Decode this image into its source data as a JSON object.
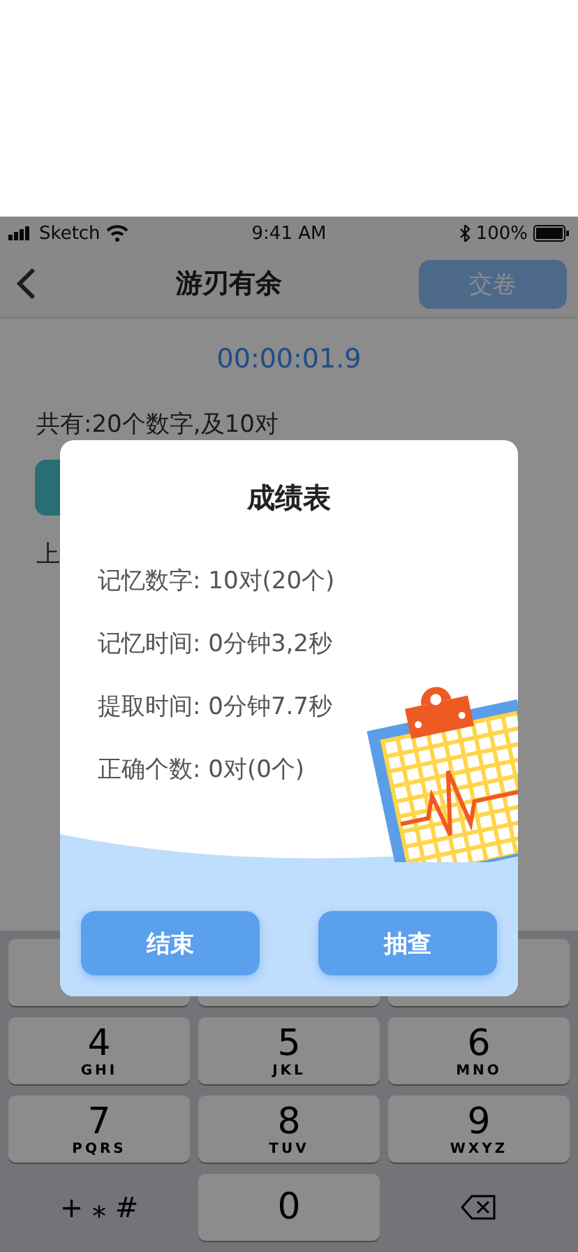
{
  "status_bar": {
    "carrier": "Sketch",
    "time": "9:41 AM",
    "battery": "100%"
  },
  "nav": {
    "title": "游刃有余",
    "action": "交卷"
  },
  "timer": "00:00:01.9",
  "summary": "共有:20个数字,及10对",
  "partial_label": "上",
  "dialog": {
    "title": "成绩表",
    "lines": [
      "记忆数字: 10对(20个)",
      "记忆时间: 0分钟3,2秒",
      "提取时间: 0分钟7.7秒",
      "正确个数: 0对(0个)"
    ],
    "buttons": [
      "结束",
      "抽查"
    ]
  },
  "keypad": {
    "rows": [
      [
        {
          "kind": "hidden"
        },
        {
          "kind": "hidden"
        },
        {
          "kind": "hidden"
        }
      ],
      [
        {
          "kind": "digit",
          "digit": "4",
          "letters": "GHI"
        },
        {
          "kind": "digit",
          "digit": "5",
          "letters": "JKL"
        },
        {
          "kind": "digit",
          "digit": "6",
          "letters": "MNO"
        }
      ],
      [
        {
          "kind": "digit",
          "digit": "7",
          "letters": "PQRS"
        },
        {
          "kind": "digit",
          "digit": "8",
          "letters": "TUV"
        },
        {
          "kind": "digit",
          "digit": "9",
          "letters": "WXYZ"
        }
      ],
      [
        {
          "kind": "symbols",
          "label": "+ ⁎ #"
        },
        {
          "kind": "digit",
          "digit": "0"
        },
        {
          "kind": "delete"
        }
      ]
    ]
  }
}
